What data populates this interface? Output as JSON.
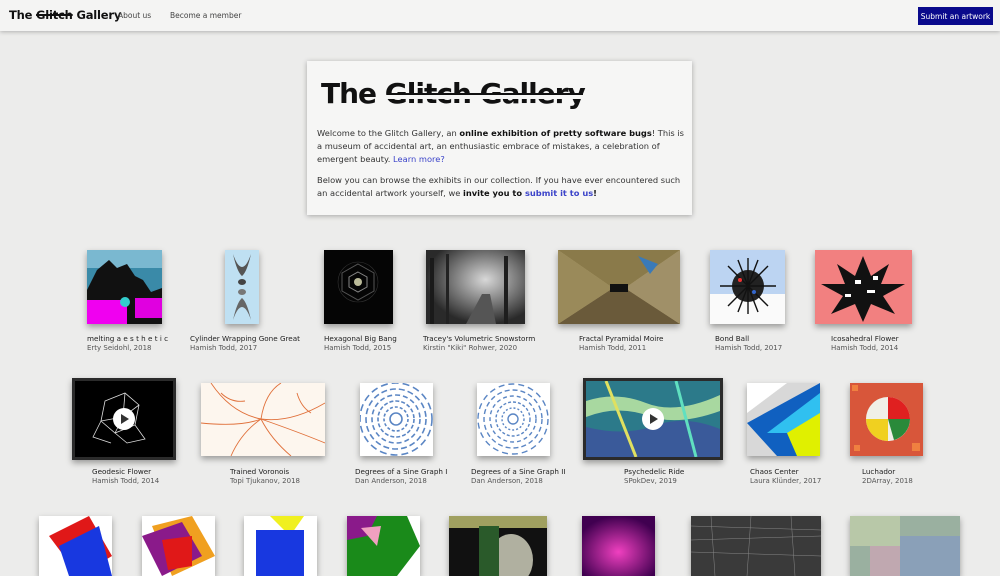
{
  "nav": {
    "brand_pre": "The ",
    "brand_glitch": "Glitch",
    "brand_post": " Gallery",
    "about": "About us",
    "member": "Become a member",
    "submit": "Submit an artwork"
  },
  "intro": {
    "title_pre": "The ",
    "title_glitch": "Glitch Gallery",
    "p1_a": "Welcome to the Glitch Gallery, an ",
    "p1_b": "online exhibition of pretty software bugs",
    "p1_c": "! This is a museum of accidental art, an enthusiastic embrace of mistakes, a celebration of emergent beauty. ",
    "p1_link": "Learn more?",
    "p2_a": "Below you can browse the exhibits in our collection. If you have ever encountered such an accidental artwork yourself, we ",
    "p2_b": "invite you to ",
    "p2_link": "submit it to us",
    "p2_c": "!"
  },
  "artworks": [
    {
      "title": "melting a e s t h e t i c",
      "meta": "Erty Seidohl, 2018",
      "icon": "melting-art-icon"
    },
    {
      "title": "Cylinder Wrapping Gone Great",
      "meta": "Hamish Todd, 2017",
      "icon": "cylinder-art-icon"
    },
    {
      "title": "Hexagonal Big Bang",
      "meta": "Hamish Todd, 2015",
      "icon": "hexagon-art-icon"
    },
    {
      "title": "Tracey's Volumetric Snowstorm",
      "meta": "Kirstin \"Kiki\" Rohwer, 2020",
      "icon": "snowstorm-art-icon"
    },
    {
      "title": "Fractal Pyramidal Moire",
      "meta": "Hamish Todd, 2011",
      "icon": "moire-art-icon"
    },
    {
      "title": "Bond Ball",
      "meta": "Hamish Todd, 2017",
      "icon": "bond-ball-art-icon"
    },
    {
      "title": "Icosahedral Flower",
      "meta": "Hamish Todd, 2014",
      "icon": "flower-art-icon"
    },
    {
      "title": "Geodesic Flower",
      "meta": "Hamish Todd, 2014",
      "icon": "geodesic-art-icon"
    },
    {
      "title": "Trained Voronois",
      "meta": "Topi Tjukanov, 2018",
      "icon": "voronoi-art-icon"
    },
    {
      "title": "Degrees of a Sine Graph I",
      "meta": "Dan Anderson, 2018",
      "icon": "sine-art-icon"
    },
    {
      "title": "Degrees of a Sine Graph II",
      "meta": "Dan Anderson, 2018",
      "icon": "sine-art-icon"
    },
    {
      "title": "Psychedelic Ride",
      "meta": "SPokDev, 2019",
      "icon": "psychedelic-art-icon"
    },
    {
      "title": "Chaos Center",
      "meta": "Laura Klünder, 2017",
      "icon": "chaos-art-icon"
    },
    {
      "title": "Luchador",
      "meta": "2DArray, 2018",
      "icon": "luchador-art-icon"
    }
  ],
  "colors": {
    "accent": "#0a0a8c",
    "link": "#3b43c9",
    "background": "#ececeb"
  }
}
